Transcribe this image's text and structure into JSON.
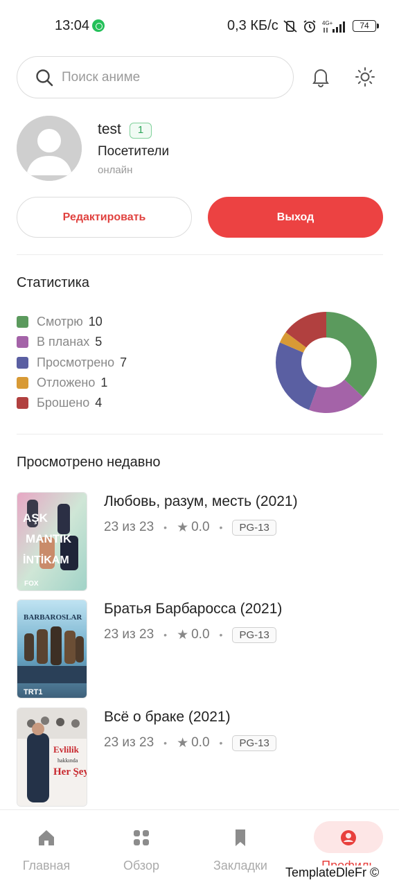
{
  "status_bar": {
    "time": "13:04",
    "network_speed": "0,3 КБ/с",
    "network_type": "4G+",
    "battery": "74"
  },
  "search": {
    "placeholder": "Поиск аниме"
  },
  "profile": {
    "username": "test",
    "level": "1",
    "group": "Посетители",
    "status": "онлайн",
    "edit_label": "Редактировать",
    "logout_label": "Выход"
  },
  "stats": {
    "title": "Статистика",
    "items": [
      {
        "label": "Смотрю",
        "value": 10,
        "color": "#5b9a5d"
      },
      {
        "label": "В планах",
        "value": 5,
        "color": "#a463a8"
      },
      {
        "label": "Просмотрено",
        "value": 7,
        "color": "#5a5fa2"
      },
      {
        "label": "Отложено",
        "value": 1,
        "color": "#d89a35"
      },
      {
        "label": "Брошено",
        "value": 4,
        "color": "#b1403f"
      }
    ]
  },
  "recent": {
    "title": "Просмотрено недавно",
    "items": [
      {
        "title": "Любовь, разум, месть (2021)",
        "episodes": "23 из 23",
        "rating": "0.0",
        "age": "PG-13",
        "poster_text": "AŞK MANTIK İNTİKAM",
        "poster_sub": "FOX"
      },
      {
        "title": "Братья Барбаросса (2021)",
        "episodes": "23 из 23",
        "rating": "0.0",
        "age": "PG-13",
        "poster_text": "BARBAROSLAR",
        "poster_sub": "TRT1"
      },
      {
        "title": "Всё о браке (2021)",
        "episodes": "23 из 23",
        "rating": "0.0",
        "age": "PG-13",
        "poster_text": "Evlilik hakkında Her Şey",
        "poster_sub": ""
      }
    ]
  },
  "nav": {
    "items": [
      {
        "label": "Главная",
        "icon": "home-icon"
      },
      {
        "label": "Обзор",
        "icon": "grid-icon"
      },
      {
        "label": "Закладки",
        "icon": "bookmark-icon"
      },
      {
        "label": "Профиль",
        "icon": "user-circle-icon"
      }
    ]
  },
  "watermark": "TemplateDleFr ©"
}
